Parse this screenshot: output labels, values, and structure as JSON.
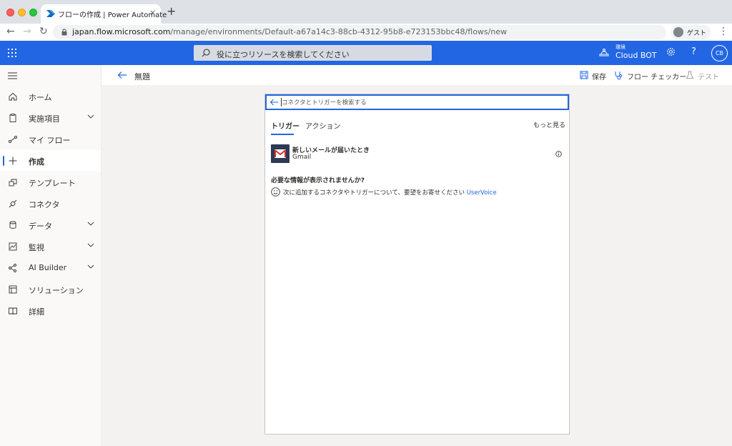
{
  "browser": {
    "tab_title": "フローの作成 | Power Automate",
    "tab_close": "×",
    "new_tab": "+",
    "url_host": "japan.flow.microsoft.com",
    "url_path": "/manage/environments/Default-a67a14c3-88cb-4312-95b8-e723153bbc48/flows/new",
    "profile_label": "ゲスト",
    "menu": "⋮",
    "nav": {
      "back": "←",
      "forward": "→",
      "reload": "↻"
    }
  },
  "header": {
    "search_placeholder": "役に立つリソースを検索してください",
    "environment_label": "環境",
    "environment_name": "Cloud BOT",
    "help": "?",
    "user_initials": "CB",
    "brand_color": "#2266e3"
  },
  "sidebar": {
    "items": [
      {
        "label": "ホーム",
        "icon": "home-icon"
      },
      {
        "label": "実施項目",
        "icon": "clipboard-icon",
        "chevron": true
      },
      {
        "label": "マイ フロー",
        "icon": "flow-icon"
      },
      {
        "label": "作成",
        "icon": "plus-icon",
        "active": true
      },
      {
        "label": "テンプレート",
        "icon": "template-icon"
      },
      {
        "label": "コネクタ",
        "icon": "connector-icon"
      },
      {
        "label": "データ",
        "icon": "database-icon",
        "chevron": true
      },
      {
        "label": "監視",
        "icon": "monitor-icon",
        "chevron": true
      },
      {
        "label": "AI Builder",
        "icon": "ai-builder-icon",
        "chevron": true
      },
      {
        "label": "ソリューション",
        "icon": "solution-icon"
      },
      {
        "label": "詳細",
        "icon": "book-icon"
      }
    ]
  },
  "command_bar": {
    "title": "無題",
    "save": "保存",
    "flow_checker": "フロー チェッカー",
    "test": "テスト"
  },
  "panel": {
    "search_placeholder": "コネクタとトリガーを検索する",
    "tabs": [
      "トリガー",
      "アクション"
    ],
    "active_tab": "トリガー",
    "see_more": "もっと見る",
    "trigger": {
      "name": "新しいメールが届いたとき",
      "connector": "Gmail"
    },
    "missing_title": "必要な情報が表示されませんか?",
    "feedback_text": "次に追加するコネクタやトリガーについて、要望をお寄せください",
    "feedback_link": "UserVoice"
  }
}
